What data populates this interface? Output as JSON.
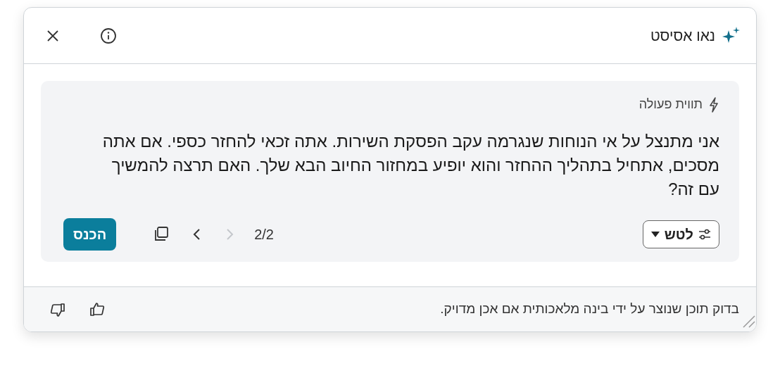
{
  "header": {
    "title": "נאו אסיסט"
  },
  "card": {
    "label": "תווית פעולה",
    "message": "אני מתנצל על אי הנוחות שנגרמה עקב הפסקת השירות. אתה זכאי להחזר כספי. אם אתה מסכים, אתחיל בתהליך ההחזר והוא יופיע במחזור החיוב הבא שלך. האם תרצה להמשיך עם זה?",
    "tone_button": "לטש",
    "pager": {
      "text": "2/2",
      "prev_disabled": true,
      "next_disabled": false
    },
    "insert_button": "הכנס"
  },
  "footer": {
    "disclaimer": "בדוק תוכן שנוצר על ידי בינה מלאכותית אם אכן מדויק."
  }
}
